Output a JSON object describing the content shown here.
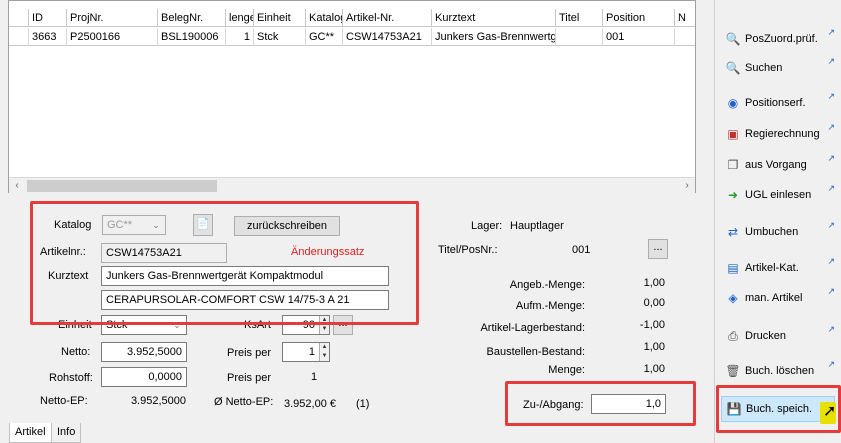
{
  "grid": {
    "columns": [
      "ID",
      "ProjNr.",
      "BelegNr.",
      "lenge",
      "Einheit",
      "Katalog",
      "Artikel-Nr.",
      "Kurztext",
      "Titel",
      "Position",
      "N"
    ],
    "rows": [
      [
        "3663",
        "P2500166",
        "BSL190006",
        "1",
        "Stck",
        "GC**",
        "CSW14753A21",
        "Junkers Gas-Brennwertge",
        "",
        "001",
        ""
      ]
    ]
  },
  "form": {
    "katalog_label": "Katalog",
    "katalog_value": "GC**",
    "zurueck_button": "zurückschreiben",
    "artikelnr_label": "Artikelnr.:",
    "artikelnr_value": "CSW14753A21",
    "aenderungssatz": "Änderungssatz",
    "kurztext_label": "Kurztext",
    "kurztext1": "Junkers Gas-Brennwertgerät Kompaktmodul",
    "kurztext2": "CERAPURSOLAR-COMFORT CSW 14/75-3 A 21",
    "einheit_label": "Einheit",
    "einheit_value": "Stck",
    "ksart_label": "KsArt",
    "ksart_value": "90",
    "netto_label": "Netto:",
    "netto_value": "3.952,5000",
    "preis_per_label": "Preis per",
    "preis_per_value": "1",
    "rohstoff_label": "Rohstoff:",
    "rohstoff_value": "0,0000",
    "preis_per2_label": "Preis per",
    "preis_per2_value": "1",
    "netto_ep_label": "Netto-EP:",
    "netto_ep_value": "3.952,5000",
    "avg_netto_ep_label": "Ø Netto-EP:",
    "avg_netto_ep_value": "3.952,00 €",
    "avg_netto_ep_count": "(1)"
  },
  "stock": {
    "lager_label": "Lager:",
    "lager_value": "Hauptlager",
    "titelpos_label": "Titel/PosNr.:",
    "titelpos_value": "001",
    "angeb_label": "Angeb.-Menge:",
    "angeb_value": "1,00",
    "aufm_label": "Aufm.-Menge:",
    "aufm_value": "0,00",
    "lagerbestand_label": "Artikel-Lagerbestand:",
    "lagerbestand_value": "-1,00",
    "baustelle_label": "Baustellen-Bestand:",
    "baustelle_value": "1,00",
    "menge_label": "Menge:",
    "menge_value": "1,00",
    "zuabgang_label": "Zu-/Abgang:",
    "zuabgang_value": "1,0"
  },
  "tabs": [
    "Artikel",
    "Info"
  ],
  "panel": {
    "buttons": [
      {
        "label": "PosZuord.prüf.",
        "icon": "magnifier-check-icon"
      },
      {
        "label": "Suchen",
        "icon": "magnifier-icon"
      },
      {
        "label": "Positionserf.",
        "icon": "position-icon"
      },
      {
        "label": "Regierechnung",
        "icon": "invoice-icon"
      },
      {
        "label": "aus Vorgang",
        "icon": "document-copy-icon"
      },
      {
        "label": "UGL einlesen",
        "icon": "import-arrow-icon"
      },
      {
        "label": "Umbuchen",
        "icon": "transfer-icon"
      },
      {
        "label": "Artikel-Kat.",
        "icon": "catalog-icon"
      },
      {
        "label": "man. Artikel",
        "icon": "manual-article-icon"
      },
      {
        "label": "Drucken",
        "icon": "printer-icon"
      },
      {
        "label": "Buch. löschen",
        "icon": "trash-icon"
      },
      {
        "label": "Buch. speich.",
        "icon": "save-disk-icon"
      }
    ]
  },
  "colors": {
    "highlight_box": "#e43b3b",
    "aenderung_text": "#e02020",
    "accent": "#1e64c8"
  }
}
